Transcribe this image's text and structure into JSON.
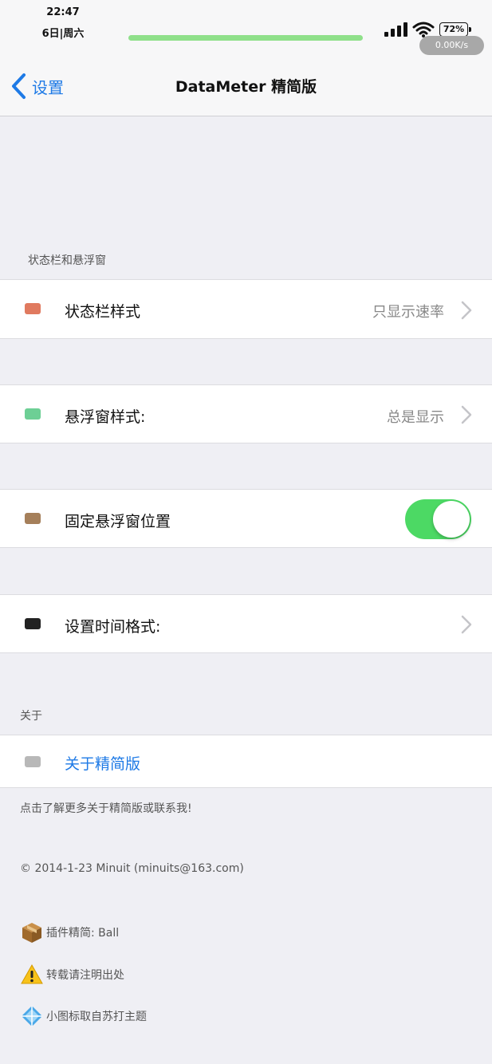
{
  "statusbar": {
    "time": "22:47",
    "date": "6日|周六",
    "battery": "72%",
    "net_speed": "0.00K/s"
  },
  "nav": {
    "back_label": "设置",
    "title": "DataMeter 精简版"
  },
  "sections": {
    "statusbar_float": "状态栏和悬浮窗",
    "about": "关于"
  },
  "rows": {
    "statusbar_style": {
      "label": "状态栏样式",
      "value": "只显示速率",
      "icon_color": "#e07a5f"
    },
    "float_style": {
      "label": "悬浮窗样式:",
      "value": "总是显示",
      "icon_color": "#6dcf95"
    },
    "fix_float": {
      "label": "固定悬浮窗位置",
      "enabled": true,
      "icon_color": "#a57f5a"
    },
    "time_format": {
      "label": "设置时间格式:",
      "icon_color": "#222222"
    },
    "about": {
      "label": "关于精简版",
      "icon_color": "#b8b8b8"
    }
  },
  "footer": {
    "about_note": "点击了解更多关于精简版或联系我!",
    "copyright": "© 2014-1-23 Minuit (minuits@163.com)",
    "credits": [
      {
        "icon": "package-icon",
        "text": "插件精简: Ball"
      },
      {
        "icon": "warning-icon",
        "text": "转载请注明出处"
      },
      {
        "icon": "diamond-tile-icon",
        "text": "小图标取自苏打主题"
      }
    ]
  },
  "colors": {
    "accent": "#1e7ae6",
    "toggle_on": "#4cd964",
    "background": "#efeff4"
  }
}
